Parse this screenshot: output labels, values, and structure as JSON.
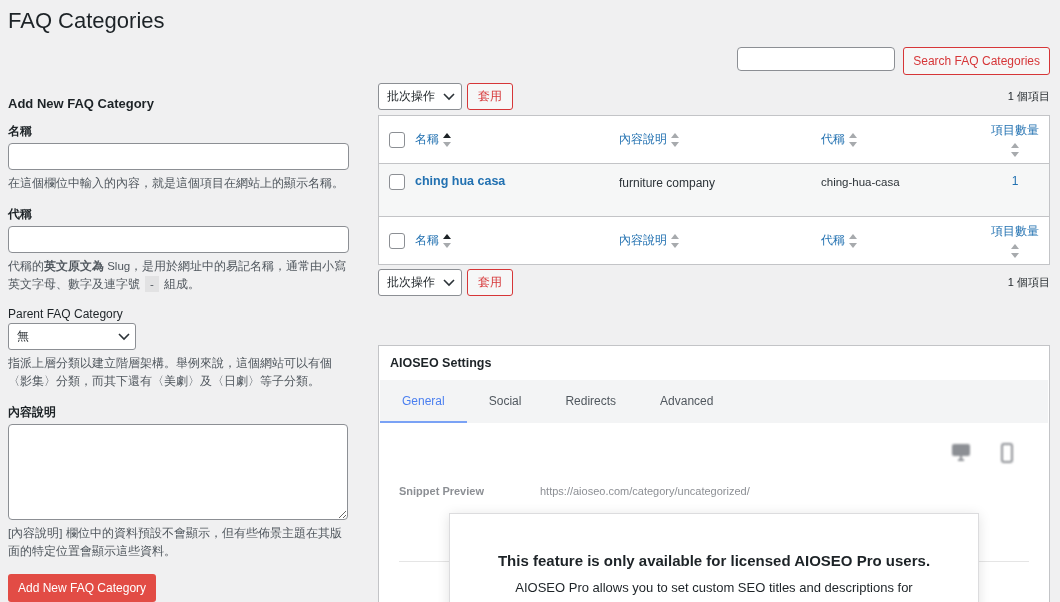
{
  "page_title": "FAQ Categories",
  "search": {
    "button": "Search FAQ Categories"
  },
  "form": {
    "heading": "Add New FAQ Category",
    "name_field": {
      "label": "名稱",
      "hint": "在這個欄位中輸入的內容，就是這個項目在網站上的顯示名稱。"
    },
    "slug_field": {
      "label": "代稱",
      "hint": {
        "before": "代稱的**英文原文為** Slug，是用於網址中的易記名稱，通常由小寫英文字母、數字及連字號",
        "code": "-",
        "after": "組成。"
      }
    },
    "parent_field": {
      "label": "Parent FAQ Category",
      "value": "無",
      "hint": "指派上層分類以建立階層架構。舉例來說，這個網站可以有個〈影集〉分類，而其下還有〈美劇〉及〈日劇〉等子分類。"
    },
    "description_field": {
      "label": "內容說明",
      "hint": "[內容說明] 欄位中的資料預設不會顯示，但有些佈景主題在其版面的特定位置會顯示這些資料。"
    },
    "submit": "Add New FAQ Category"
  },
  "bulk_top": {
    "select": "批次操作",
    "apply": "套用",
    "count": "1 個項目"
  },
  "table": {
    "select_all_checked": false,
    "footer_select_all_checked": false,
    "columns": [
      {
        "label": "名稱",
        "sorted": true
      },
      {
        "label": "內容說明",
        "sorted": false
      },
      {
        "label": "代稱",
        "sorted": false
      },
      {
        "label": "項目數量",
        "sorted": false
      }
    ],
    "rows": [
      {
        "checked": false,
        "name": "ching hua casa",
        "description": "furniture company",
        "slug": "ching-hua-casa",
        "count": "1"
      }
    ],
    "footer_columns": [
      {
        "label": "名稱",
        "sorted": true
      },
      {
        "label": "內容說明",
        "sorted": false
      },
      {
        "label": "代稱",
        "sorted": false
      },
      {
        "label": "項目數量",
        "sorted": false
      }
    ]
  },
  "bulk_bottom": {
    "select": "批次操作",
    "apply": "套用",
    "count": "1 個項目"
  },
  "aioseo": {
    "title": "AIOSEO Settings",
    "tabs": [
      {
        "label": "General",
        "selected": true
      },
      {
        "label": "Social",
        "selected": false
      },
      {
        "label": "Redirects",
        "selected": false
      },
      {
        "label": "Advanced",
        "selected": false
      }
    ],
    "snippet_label": "Snippet Preview",
    "snippet_url": "https://aioseo.com/category/uncategorized/",
    "notice": {
      "heading": "This feature is only available for licensed AIOSEO Pro users.",
      "text": "AIOSEO Pro allows you to set custom SEO titles and descriptions for"
    }
  }
}
